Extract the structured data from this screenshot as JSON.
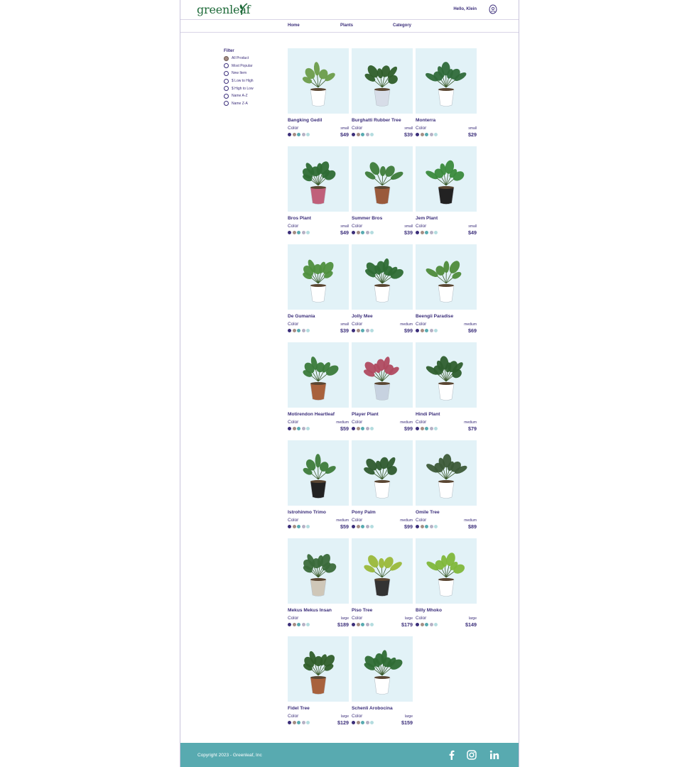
{
  "header": {
    "logo": "greenleaf",
    "greeting": "Hello, Klein"
  },
  "nav": {
    "items": [
      "Home",
      "Plants",
      "Category"
    ]
  },
  "filter": {
    "title": "Filter",
    "options": [
      "All Product",
      "Most Popular",
      "New Item",
      "$ Low to High",
      "$ High to Low",
      "Name A-Z",
      "Name Z-A"
    ],
    "selected": "All Product"
  },
  "colors": {
    "brand": "#3b2e7a",
    "accent": "#58aab0",
    "card_bg": "#e2f2f7",
    "logo": "#1f6b3a"
  },
  "swatches": [
    "#3b2e7a",
    "#a58d84",
    "#58aab0",
    "#b6b0c4",
    "#b4dcdf"
  ],
  "color_label": "Color",
  "products": [
    {
      "name": "Bangking Gedil",
      "size": "small",
      "price": "$49"
    },
    {
      "name": "Burghatti Rubber Tree",
      "size": "small",
      "price": "$39"
    },
    {
      "name": "Monterra",
      "size": "small",
      "price": "$29"
    },
    {
      "name": "Bros Plant",
      "size": "small",
      "price": "$49"
    },
    {
      "name": "Summer Bros",
      "size": "small",
      "price": "$39"
    },
    {
      "name": "Jem Plant",
      "size": "small",
      "price": "$49"
    },
    {
      "name": "De Gumania",
      "size": "small",
      "price": "$39"
    },
    {
      "name": "Jolly Mee",
      "size": "medium",
      "price": "$99"
    },
    {
      "name": "Beengii Paradise",
      "size": "medium",
      "price": "$69"
    },
    {
      "name": "Motirendon Heartleaf",
      "size": "medium",
      "price": "$59"
    },
    {
      "name": "Player Plant",
      "size": "medium",
      "price": "$99"
    },
    {
      "name": "Hindi Plant",
      "size": "medium",
      "price": "$79"
    },
    {
      "name": "Istrohinmo Trimo",
      "size": "medium",
      "price": "$59"
    },
    {
      "name": "Pony Palm",
      "size": "medium",
      "price": "$99"
    },
    {
      "name": "Omile Tree",
      "size": "medium",
      "price": "$89"
    },
    {
      "name": "Mekus Mekus Insan",
      "size": "large",
      "price": "$189"
    },
    {
      "name": "Piso Tree",
      "size": "large",
      "price": "$179"
    },
    {
      "name": "Billy Mhoko",
      "size": "large",
      "price": "$149"
    },
    {
      "name": "Fidel Tree",
      "size": "large",
      "price": "$129"
    },
    {
      "name": "Schenli Arobocina",
      "size": "large",
      "price": "$159"
    }
  ],
  "footer": {
    "copyright": "Copyright 2023 - Greenleaf, Inc",
    "social": [
      "facebook-icon",
      "instagram-icon",
      "linkedin-icon"
    ]
  }
}
